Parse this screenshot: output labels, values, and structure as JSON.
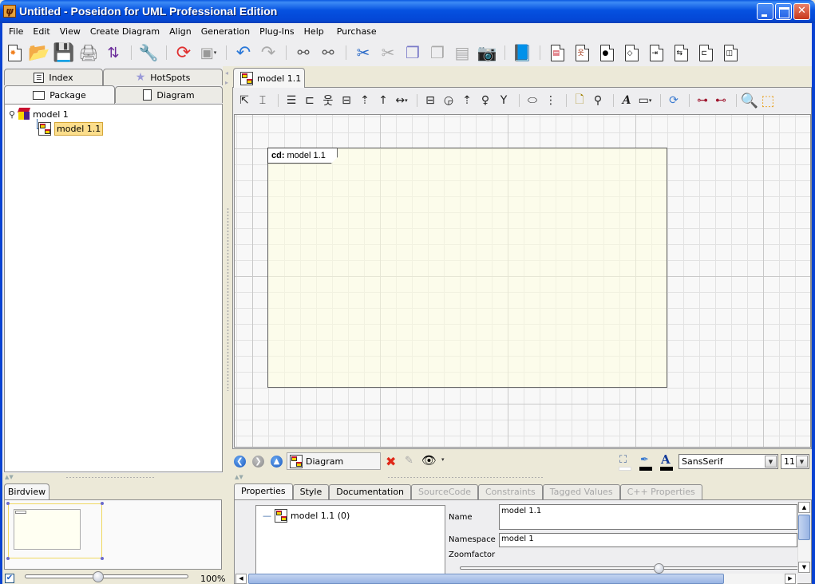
{
  "window": {
    "title": "Untitled - Poseidon for UML Professional Edition",
    "app_icon": "poseidon-logo-icon",
    "controls": {
      "minimize": "minimize-icon",
      "maximize": "maximize-icon",
      "close": "close-icon"
    }
  },
  "menu": [
    {
      "label": "File"
    },
    {
      "label": "Edit"
    },
    {
      "label": "View"
    },
    {
      "label": "Create Diagram"
    },
    {
      "label": "Align"
    },
    {
      "label": "Generation"
    },
    {
      "label": "Plug-Ins"
    },
    {
      "label": "Help"
    },
    {
      "label": "Purchase"
    }
  ],
  "toolbar": {
    "groups": [
      [
        "new-project-icon",
        "open-project-icon",
        "save-project-icon",
        "print-icon",
        "import-icon"
      ],
      [
        "settings-wrench-icon"
      ],
      [
        "roundtrip-icon",
        "generate-icon"
      ],
      [
        "undo-icon",
        "redo-icon"
      ],
      [
        "find-icon",
        "find-in-diagram-icon"
      ],
      [
        "cut-icon",
        "cut-delete-icon",
        "copy-icon",
        "copy-diagram-icon",
        "paste-icon",
        "screenshot-icon"
      ],
      [
        "book-help-icon"
      ],
      [
        "class-diagram-icon",
        "use-case-diagram-icon",
        "state-diagram-icon",
        "activity-diagram-icon",
        "sequence-diagram-icon",
        "collaboration-diagram-icon",
        "component-diagram-icon",
        "deployment-diagram-icon"
      ]
    ]
  },
  "left_panel": {
    "tabs": [
      {
        "label": "Index",
        "icon": "index-list-icon"
      },
      {
        "label": "HotSpots",
        "icon": "star-icon"
      },
      {
        "label": "Package",
        "icon": "folder-icon",
        "active": true
      },
      {
        "label": "Diagram",
        "icon": "page-icon"
      }
    ],
    "tree": [
      {
        "label": "model 1",
        "icon": "model-cube-icon",
        "level": 0
      },
      {
        "label": "model 1.1",
        "icon": "class-diagram-icon",
        "level": 1,
        "selected": true
      }
    ]
  },
  "birdview": {
    "tab_label": "Birdview",
    "zoom_label": "100%",
    "zoom_enabled": true,
    "zoom_slider_fraction": 0.45
  },
  "diagram": {
    "tab_label": "model 1.1",
    "frame_kind": "cd:",
    "frame_name": "model 1.1",
    "toolbar_icons": [
      "select-arrow-icon",
      "vertical-space-icon",
      "class-icon",
      "package-icon",
      "actor-icon",
      "use-case-actor-icon",
      "generalization-icon",
      "dependency-icon",
      "association-icon",
      "interface-icon",
      "collaboration-icon",
      "realization-icon",
      "lollipop-interface-icon",
      "required-interface-icon",
      "ellipse-icon",
      "dashed-line-icon",
      "note-icon",
      "note-anchor-icon",
      "text-icon",
      "rectangle-icon",
      "refresh-icon",
      "layout-icon",
      "layout-up-icon",
      "zoom-100-icon",
      "zoom-fit-icon"
    ]
  },
  "nav_bar": {
    "back": "back-icon",
    "forward": "forward-icon",
    "up": "up-icon",
    "current_label": "Diagram",
    "font_family": "SansSerif",
    "font_size": "11",
    "fill_color": "#ffffff",
    "line_color": "#000000",
    "font_color": "#000000"
  },
  "properties": {
    "tabs": [
      {
        "label": "Properties",
        "state": "active"
      },
      {
        "label": "Style",
        "state": "normal"
      },
      {
        "label": "Documentation",
        "state": "normal"
      },
      {
        "label": "SourceCode",
        "state": "disabled"
      },
      {
        "label": "Constraints",
        "state": "disabled"
      },
      {
        "label": "Tagged Values",
        "state": "disabled"
      },
      {
        "label": "C++ Properties",
        "state": "disabled"
      }
    ],
    "tree_item": "model 1.1 (0)",
    "name_label": "Name",
    "name_value": "model 1.1",
    "namespace_label": "Namespace",
    "namespace_value": "model 1",
    "zoomfactor_label": "Zoomfactor",
    "zoomfactor_fraction": 0.58
  }
}
